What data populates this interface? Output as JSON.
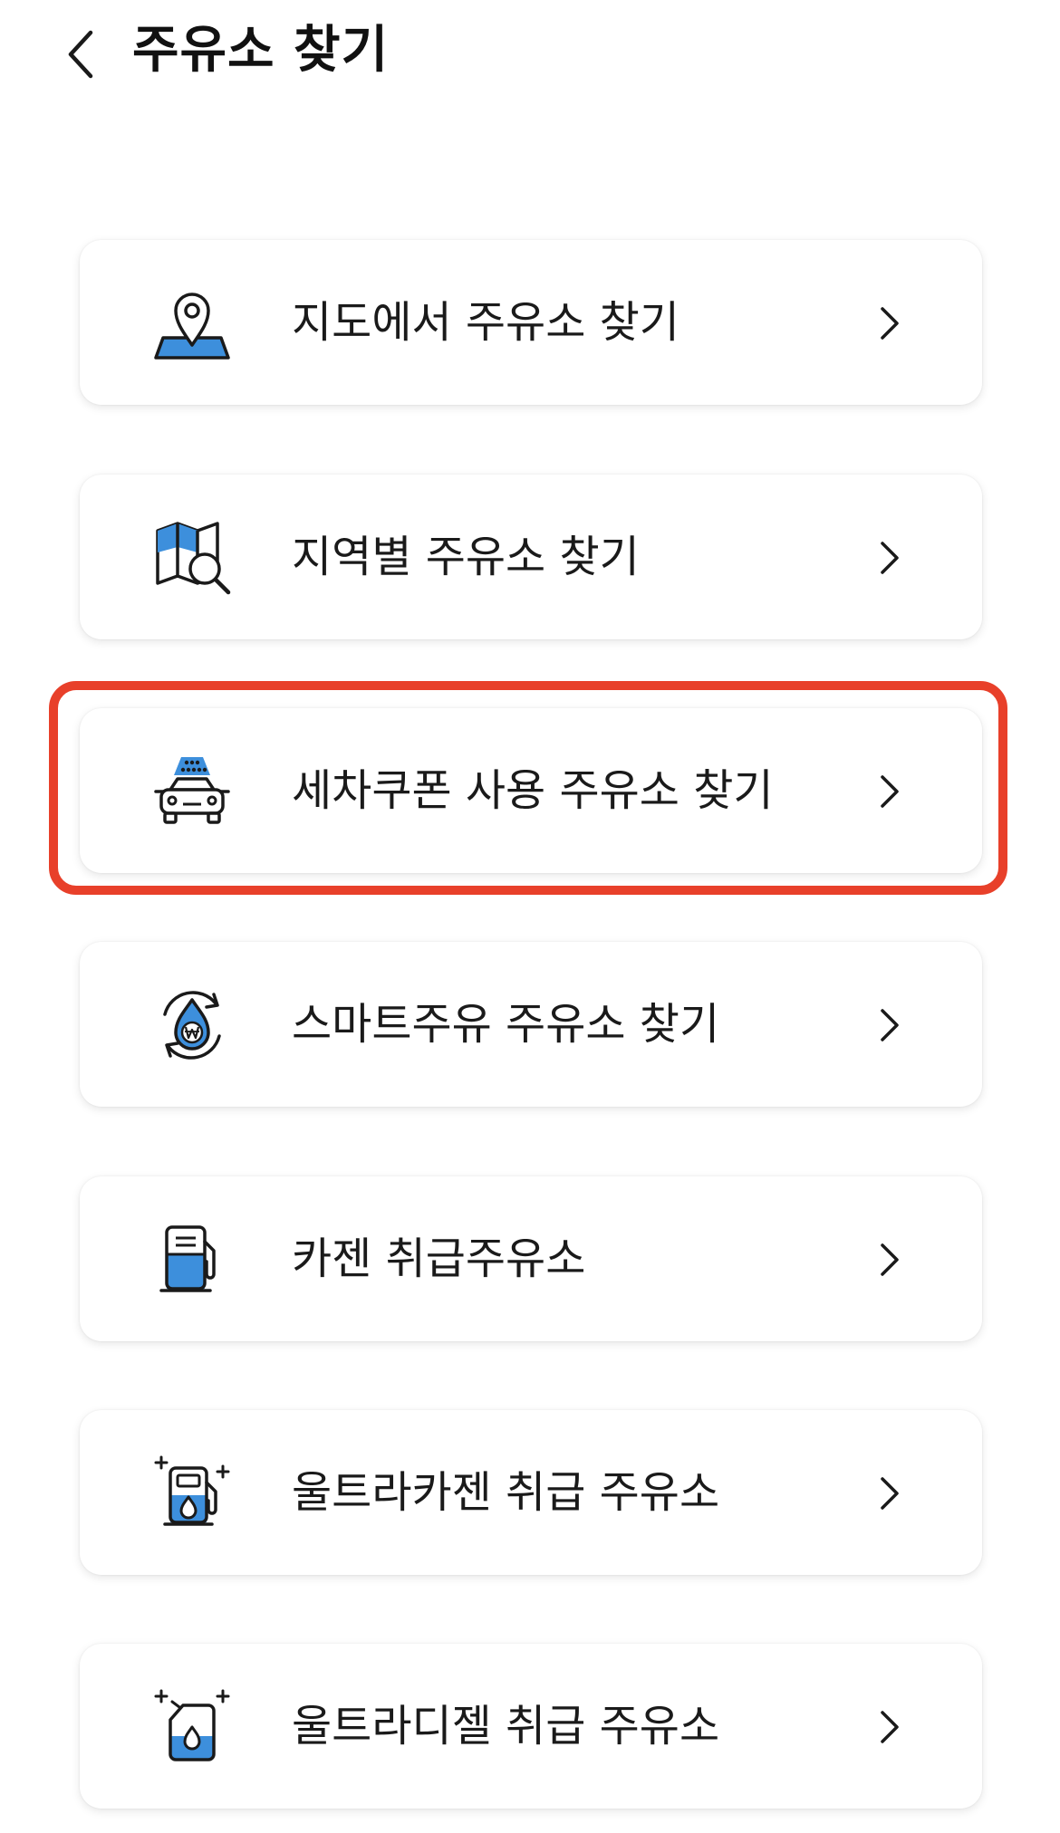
{
  "header": {
    "title": "주유소 찾기",
    "back_icon": "chevron-left-icon"
  },
  "menu": {
    "items": [
      {
        "label": "지도에서 주유소 찾기",
        "icon": "map-pin-icon"
      },
      {
        "label": "지역별 주유소 찾기",
        "icon": "map-search-icon"
      },
      {
        "label": "세차쿠폰 사용 주유소 찾기",
        "icon": "car-wash-icon"
      },
      {
        "label": "스마트주유 주유소 찾기",
        "icon": "smart-fuel-icon"
      },
      {
        "label": "카젠 취급주유소",
        "icon": "fuel-pump-icon"
      },
      {
        "label": "울트라카젠 취급 주유소",
        "icon": "fuel-pump-drop-icon"
      },
      {
        "label": "울트라디젤 취급 주유소",
        "icon": "fuel-can-icon"
      }
    ],
    "highlighted_item": "세차쿠폰 사용 주유소 찾기"
  },
  "colors": {
    "accent_blue": "#3d8fdc",
    "icon_stroke": "#1a1a1a",
    "highlight_red": "#e8402a"
  }
}
